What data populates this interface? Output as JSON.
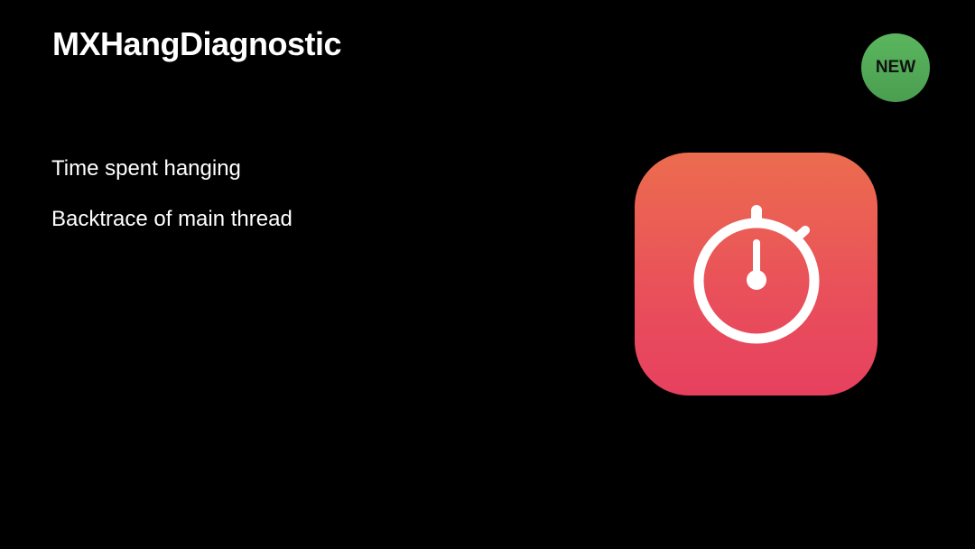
{
  "slide": {
    "title": "MXHangDiagnostic",
    "bullets": [
      "Time spent hanging",
      "Backtrace of main thread"
    ],
    "badge": "NEW",
    "icon": "stopwatch-icon",
    "colors": {
      "background": "#000000",
      "badge": "#55ad58",
      "icon_top": "#ec6c4e",
      "icon_bottom": "#e7405f"
    }
  }
}
